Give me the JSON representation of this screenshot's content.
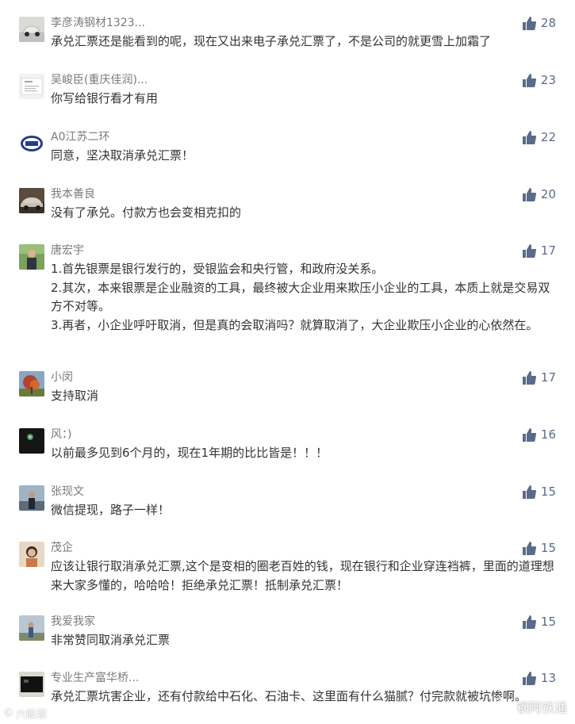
{
  "comments": [
    {
      "nickname": "李彦涛钢材1323...",
      "text": "承兑汇票还是能看到的呢，现在又出来电子承兑汇票了，不是公司的就更雪上加霜了",
      "likes": "28",
      "avatar": "car-photo"
    },
    {
      "nickname": "吴峻臣(重庆佳润)...",
      "text": "你写给银行看才有用",
      "likes": "23",
      "avatar": "business-card"
    },
    {
      "nickname": "A0江苏二环",
      "text": "同意，坚决取消承兑汇票！",
      "likes": "22",
      "avatar": "company-logo"
    },
    {
      "nickname": "我本善良",
      "text": "没有了承兑。付款方也会变相克扣的",
      "likes": "20",
      "avatar": "car-photo"
    },
    {
      "nickname": "唐宏宇",
      "text": "1.首先银票是银行发行的，受银监会和央行管，和政府没关系。\n2.其次，本来银票是企业融资的工具，最终被大企业用来欺压小企业的工具，本质上就是交易双方不对等。\n3.再者，小企业呼吁取消，但是真的会取消吗？就算取消了，大企业欺压小企业的心依然在。",
      "likes": "17",
      "avatar": "person-photo"
    },
    {
      "nickname": "小闵",
      "text": "支持取消",
      "likes": "17",
      "avatar": "tree-photo"
    },
    {
      "nickname": "风：)",
      "text": "以前最多见到6个月的，现在1年期的比比皆是！！！",
      "likes": "16",
      "avatar": "dark-photo"
    },
    {
      "nickname": "张现文",
      "text": "微信提现，路子一样！",
      "likes": "15",
      "avatar": "person-photo"
    },
    {
      "nickname": "茂企",
      "text": "应该让银行取消承兑汇票,这个是变相的圈老百姓的钱，现在银行和企业穿连裆裤，里面的道理想来大家多懂的，哈哈哈！拒绝承兑汇票！抵制承兑汇票！",
      "likes": "15",
      "avatar": "person-photo"
    },
    {
      "nickname": "我爱我家",
      "text": "非常赞同取消承兑汇票",
      "likes": "15",
      "avatar": "person-photo"
    },
    {
      "nickname": "专业生产富华桥...",
      "text": "承兑汇票坑害企业，还有付款给中石化、石油卡、这里面有什么猫腻？付完款就被坑惨啊。",
      "likes": "13",
      "avatar": "dark-photo"
    }
  ],
  "watermark_left": "六股寨",
  "watermark_right": "钢阿铁通",
  "colors": {
    "nickname": "#7a7a7a",
    "text": "#333333",
    "like": "#5a6b8a"
  }
}
